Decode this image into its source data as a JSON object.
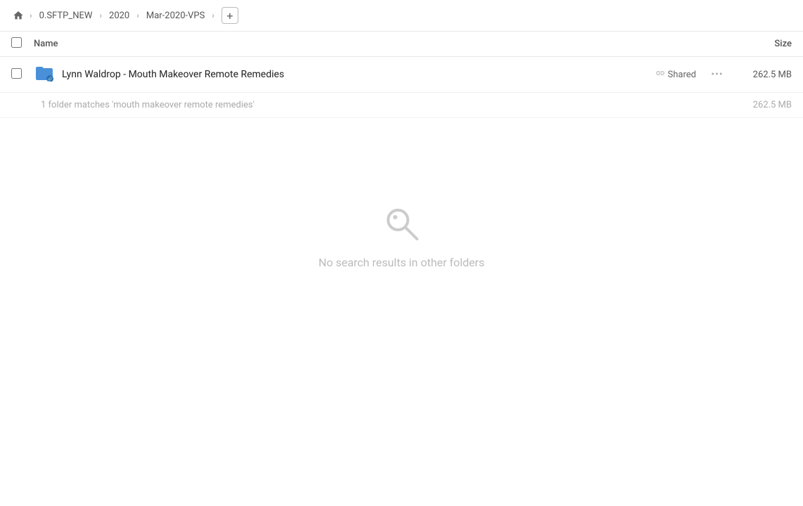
{
  "breadcrumb": {
    "home_icon": "🏠",
    "items": [
      {
        "label": "0.SFTP_NEW"
      },
      {
        "label": "2020"
      },
      {
        "label": "Mar-2020-VPS"
      }
    ],
    "add_button_label": "+"
  },
  "columns": {
    "name_label": "Name",
    "size_label": "Size"
  },
  "file_row": {
    "name": "Lynn Waldrop - Mouth Makeover Remote Remedies",
    "shared_label": "Shared",
    "size": "262.5 MB"
  },
  "summary": {
    "text": "1 folder matches 'mouth makeover remote remedies'",
    "size": "262.5 MB"
  },
  "empty_state": {
    "message": "No search results in other folders"
  },
  "more_icon": "···"
}
